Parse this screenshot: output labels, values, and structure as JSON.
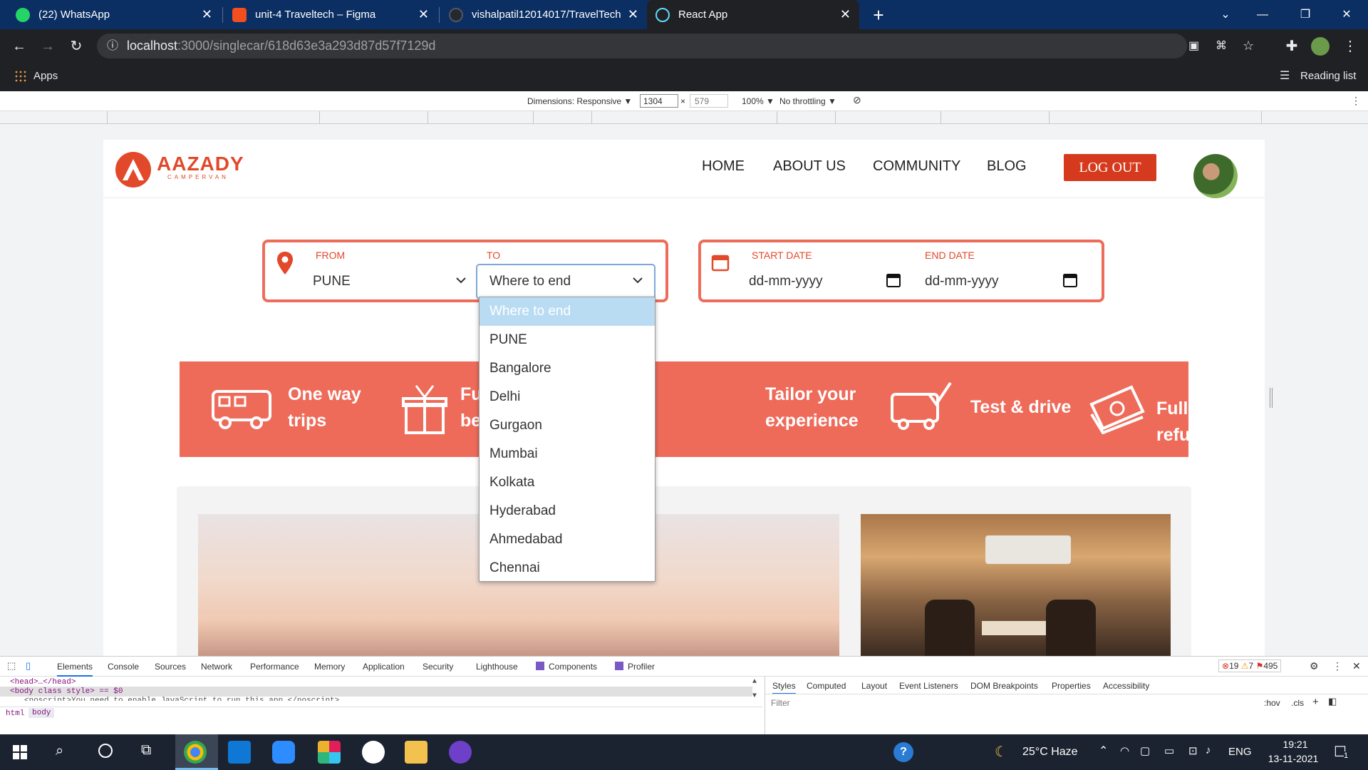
{
  "browser": {
    "tabs": [
      {
        "title": "(22) WhatsApp",
        "icon": "whatsapp-icon",
        "color": "#25d366"
      },
      {
        "title": "unit-4 Traveltech – Figma",
        "icon": "figma-icon",
        "color": "#f24e1e"
      },
      {
        "title": "vishalpatil12014017/TravelTech",
        "icon": "github-icon",
        "color": "#24292e"
      },
      {
        "title": "React App",
        "icon": "react-icon",
        "color": "#61dafb"
      }
    ],
    "url_host": "localhost",
    "url_path": ":3000/singlecar/618d63e3a293d87d57f7129d",
    "apps_label": "Apps",
    "reading_list": "Reading list"
  },
  "device_toolbar": {
    "dimensions": "Dimensions: Responsive ▼",
    "width": "1304",
    "times": "×",
    "height": "579",
    "zoom": "100% ▼",
    "throttling": "No throttling ▼"
  },
  "site": {
    "logo_text": "AAZADY",
    "logo_sub": "CAMPERVAN",
    "nav": [
      "HOME",
      "ABOUT US",
      "COMMUNITY",
      "BLOG"
    ],
    "logout": "LOG OUT",
    "search": {
      "from_label": "FROM",
      "from_value": "PUNE",
      "to_label": "TO",
      "to_value": "Where to end",
      "start_label": "START DATE",
      "start_value": "dd-mm-yyyy",
      "end_label": "END DATE",
      "end_value": "dd-mm-yyyy"
    },
    "dropdown_options": [
      "Where to end",
      "PUNE",
      "Bangalore",
      "Delhi",
      "Gurgaon",
      "Mumbai",
      "Kolkata",
      "Hyderabad",
      "Ahmedabad",
      "Chennai"
    ],
    "features": [
      {
        "line1": "One way",
        "line2": "trips"
      },
      {
        "line1": "Fu",
        "line2": "be"
      },
      {
        "line1": "Tailor your",
        "line2": "experience"
      },
      {
        "line1": "Test & drive",
        "line2": ""
      },
      {
        "line1": "Full refund!",
        "line2": ""
      }
    ],
    "accent": "#ee6b5a"
  },
  "devtools": {
    "tabs": [
      "Elements",
      "Console",
      "Sources",
      "Network",
      "Performance",
      "Memory",
      "Application",
      "Security",
      "Lighthouse",
      "Components",
      "Profiler"
    ],
    "errors": "19",
    "warnings": "7",
    "issues": "495",
    "dom_line1": "<head>…</head>",
    "dom_line2": "<body class style> == $0",
    "dom_line3": "<noscript>You need to enable JavaScript to run this app.</noscript>",
    "crumbs": [
      "html",
      "body"
    ],
    "style_tabs": [
      "Styles",
      "Computed",
      "Layout",
      "Event Listeners",
      "DOM Breakpoints",
      "Properties",
      "Accessibility"
    ],
    "filter_placeholder": "Filter",
    "hov": ":hov",
    "cls": ".cls"
  },
  "taskbar": {
    "weather": "25°C  Haze",
    "lang": "ENG",
    "time": "19:21",
    "date": "13-11-2021",
    "notif": "1"
  }
}
